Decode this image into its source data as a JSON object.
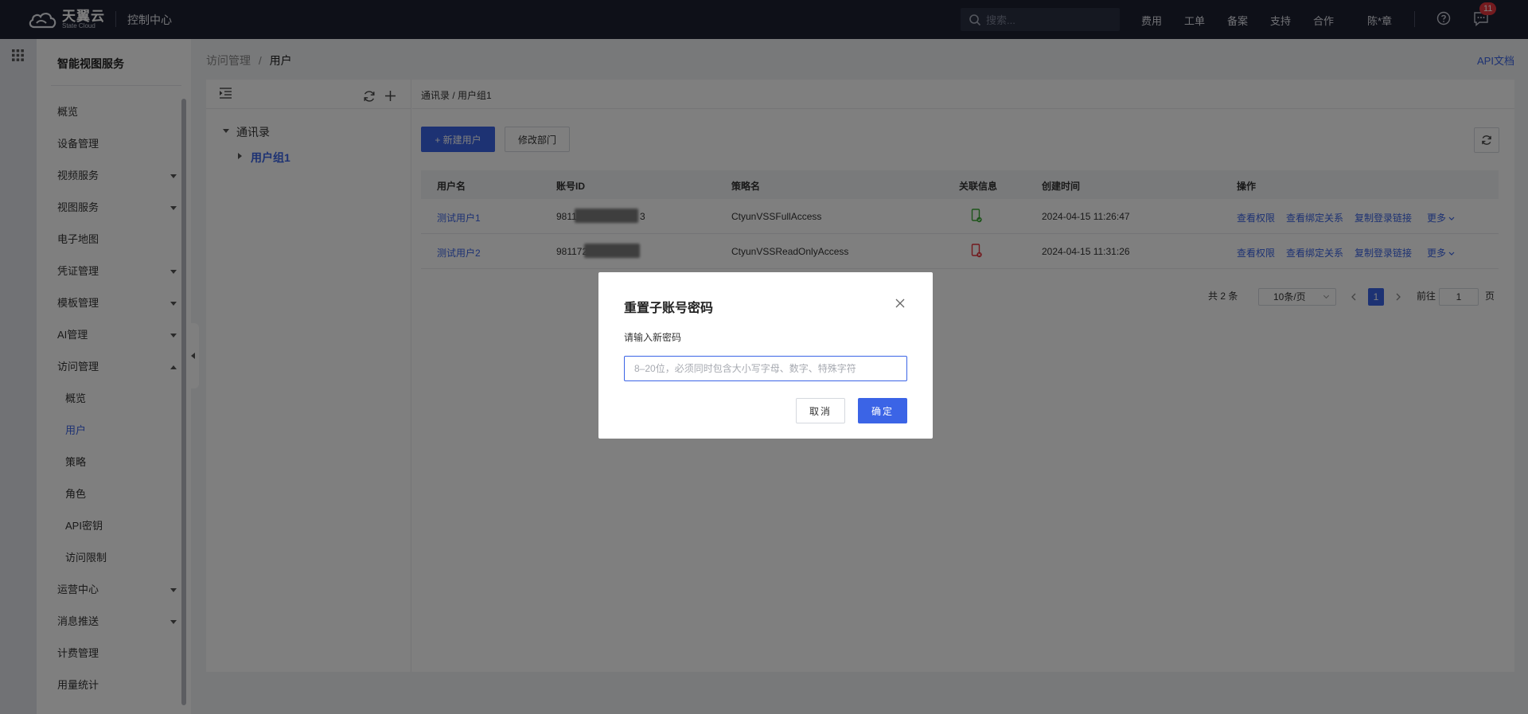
{
  "topbar": {
    "logo_name": "天翼云",
    "logo_sub": "State Cloud",
    "console_title": "控制中心",
    "search_placeholder": "搜索...",
    "nav": [
      "费用",
      "工单",
      "备案",
      "支持",
      "合作"
    ],
    "user": "陈*章",
    "notification_count": "11"
  },
  "sidebar": {
    "title": "智能视图服务",
    "items": [
      {
        "label": "概览"
      },
      {
        "label": "设备管理"
      },
      {
        "label": "视频服务",
        "caret": "down"
      },
      {
        "label": "视图服务",
        "caret": "down"
      },
      {
        "label": "电子地图"
      },
      {
        "label": "凭证管理",
        "caret": "down"
      },
      {
        "label": "模板管理",
        "caret": "down"
      },
      {
        "label": "AI管理",
        "caret": "down"
      },
      {
        "label": "访问管理",
        "caret": "up"
      },
      {
        "label": "概览",
        "sub": true
      },
      {
        "label": "用户",
        "sub": true,
        "active": true
      },
      {
        "label": "策略",
        "sub": true
      },
      {
        "label": "角色",
        "sub": true
      },
      {
        "label": "API密钥",
        "sub": true
      },
      {
        "label": "访问限制",
        "sub": true
      },
      {
        "label": "运营中心",
        "caret": "down"
      },
      {
        "label": "消息推送",
        "caret": "down"
      },
      {
        "label": "计费管理"
      },
      {
        "label": "用量统计"
      }
    ]
  },
  "breadcrumb": {
    "parent": "访问管理",
    "separator": "/",
    "current": "用户"
  },
  "api_doc_link": "API文档",
  "tree": {
    "root": "通讯录",
    "child": "用户组1"
  },
  "content": {
    "crumb": "通讯录 / 用户组1",
    "new_user_button": "+ 新建用户",
    "edit_dept_button": "修改部门"
  },
  "table": {
    "headers": [
      "用户名",
      "账号ID",
      "策略名",
      "关联信息",
      "创建时间",
      "操作"
    ],
    "rows": [
      {
        "username": "测试用户1",
        "account_prefix": "9811",
        "account_suffix": "3",
        "policy": "CtyunVSSFullAccess",
        "link_status": "linked",
        "created": "2024-04-15 11:26:47"
      },
      {
        "username": "测试用户2",
        "account_prefix": "981172",
        "account_suffix": "",
        "policy": "CtyunVSSReadOnlyAccess",
        "link_status": "unlinked",
        "created": "2024-04-15 11:31:26"
      }
    ],
    "actions": [
      "查看权限",
      "查看绑定关系",
      "复制登录链接",
      "更多"
    ]
  },
  "pagination": {
    "total": "共 2 条",
    "page_size": "10条/页",
    "current_page": "1",
    "goto_label": "前往",
    "goto_value": "1",
    "page_unit": "页"
  },
  "colors": {
    "primary": "#3b64e6",
    "topbar": "#1c2031",
    "linked": "#3aaa35",
    "unlinked": "#e5323a"
  },
  "dialog": {
    "title": "重置子账号密码",
    "label": "请输入新密码",
    "input_value": "",
    "placeholder": "8–20位，必须同时包含大小写字母、数字、特殊字符",
    "cancel": "取消",
    "confirm": "确定"
  }
}
